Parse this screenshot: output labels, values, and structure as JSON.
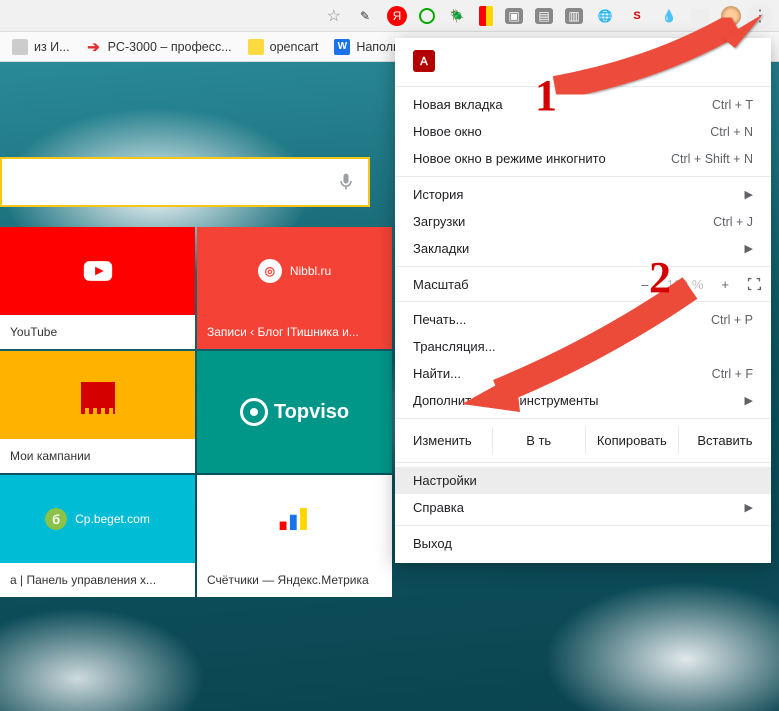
{
  "toolbar": {
    "extensions": [
      "eyedropper",
      "yandex",
      "green",
      "beetle",
      "flag",
      "gray1",
      "gray2",
      "gray3",
      "globe",
      "seo",
      "drop",
      "box",
      "avatar"
    ]
  },
  "bookmarks": {
    "items": [
      {
        "label": "из И...",
        "color": "#e0e0e0"
      },
      {
        "label": "PC-3000 – професс...",
        "color": "#e03030"
      },
      {
        "label": "opencart",
        "color": "#ffd940"
      },
      {
        "label": "Наполню",
        "color": "#1a73e8"
      }
    ]
  },
  "tiles": {
    "r1": [
      {
        "bg": "#ff0000",
        "name": "YouTube",
        "type": "youtube"
      },
      {
        "bg": "#f44336",
        "name": "Nibbl.ru",
        "caption": "Записи ‹ Блог IТишника и...",
        "type": "nibbl"
      }
    ],
    "r2": [
      {
        "bg": "#ffb300",
        "name": "Мои кампании",
        "type": "campaign"
      },
      {
        "bg": "#009688",
        "name": "Topviso",
        "type": "topvisor"
      }
    ],
    "r3": [
      {
        "bg": "#00bcd4",
        "name": "Cp.beget.com",
        "caption": "a | Панель управления х...",
        "type": "beget"
      },
      {
        "bg": "#ffffff",
        "name": "Счётчики — Яндекс.Метрика",
        "type": "metrika"
      }
    ]
  },
  "menu": {
    "adobe_label": "",
    "new_tab": {
      "label": "Новая вкладка",
      "shortcut": "Ctrl + T"
    },
    "new_window": {
      "label": "Новое окно",
      "shortcut": "Ctrl + N"
    },
    "incognito": {
      "label": "Новое окно в режиме инкогнито",
      "shortcut": "Ctrl + Shift + N"
    },
    "history": {
      "label": "История"
    },
    "downloads": {
      "label": "Загрузки",
      "shortcut": "Ctrl + J"
    },
    "bookmarks": {
      "label": "Закладки"
    },
    "zoom": {
      "label": "Масштаб",
      "minus": "–",
      "value": "100 %",
      "plus": "+"
    },
    "print": {
      "label": "Печать...",
      "shortcut": "Ctrl + P"
    },
    "cast": {
      "label": "Трансляция..."
    },
    "find": {
      "label": "Найти...",
      "shortcut": "Ctrl + F"
    },
    "more_tools": {
      "label": "Дополнительные инструменты"
    },
    "edit": {
      "label": "Изменить",
      "cut": "В        ть",
      "copy": "Копировать",
      "paste": "Вставить"
    },
    "settings": {
      "label": "Настройки"
    },
    "help": {
      "label": "Справка"
    },
    "exit": {
      "label": "Выход"
    }
  },
  "annotations": {
    "one": "1",
    "two": "2"
  }
}
